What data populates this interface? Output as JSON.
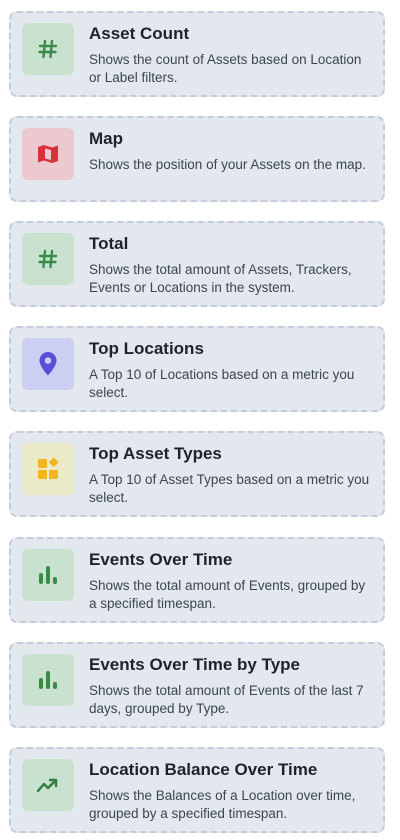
{
  "widgets": [
    {
      "title": "Asset Count",
      "description": "Shows the count of Assets based on Location or Label filters.",
      "icon": "hash-icon",
      "icon_bg": "#c8e2cf",
      "icon_color": "#3a8a4a"
    },
    {
      "title": "Map",
      "description": "Shows the position of your Assets on the map.",
      "icon": "map-icon",
      "icon_bg": "#ebc9cf",
      "icon_color": "#d6323c"
    },
    {
      "title": "Total",
      "description": "Shows the total amount of Assets, Trackers, Events or Locations in the system.",
      "icon": "hash-icon",
      "icon_bg": "#c8e2cf",
      "icon_color": "#3a8a4a"
    },
    {
      "title": "Top Locations",
      "description": "A Top 10 of Locations based on a metric you select.",
      "icon": "location-pin-icon",
      "icon_bg": "#cbcff2",
      "icon_color": "#5b4fd6"
    },
    {
      "title": "Top Asset Types",
      "description": "A Top 10 of Asset Types based on a metric you select.",
      "icon": "shapes-icon",
      "icon_bg": "#ecebc9",
      "icon_color": "#f2b61c"
    },
    {
      "title": "Events Over Time",
      "description": "Shows the total amount of Events, grouped by a specified timespan.",
      "icon": "bar-chart-icon",
      "icon_bg": "#c8e2cf",
      "icon_color": "#3a8a4a"
    },
    {
      "title": "Events Over Time by Type",
      "description": "Shows the total amount of Events of the last 7 days, grouped by Type.",
      "icon": "bar-chart-icon",
      "icon_bg": "#c8e2cf",
      "icon_color": "#3a8a4a"
    },
    {
      "title": "Location Balance Over Time",
      "description": "Shows the Balances of a Location over time, grouped by a specified timespan.",
      "icon": "trend-icon",
      "icon_bg": "#c8e2cf",
      "icon_color": "#2f7d40"
    }
  ]
}
